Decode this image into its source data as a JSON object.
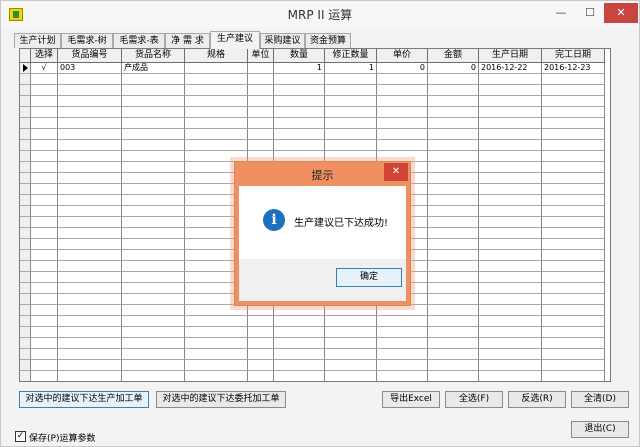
{
  "window": {
    "title": "MRP II 运算",
    "minimize_glyph": "—",
    "maximize_glyph": "☐",
    "close_glyph": "✕"
  },
  "tabs": [
    {
      "label": "生产计划",
      "active": false
    },
    {
      "label": "毛需求-树",
      "active": false
    },
    {
      "label": "毛需求-表",
      "active": false
    },
    {
      "label": "净 需 求",
      "active": false
    },
    {
      "label": "生产建议",
      "active": true
    },
    {
      "label": "采购建议",
      "active": false
    },
    {
      "label": "资金预算",
      "active": false
    }
  ],
  "grid": {
    "columns": [
      "选择",
      "货品编号",
      "货品名称",
      "规格",
      "单位",
      "数量",
      "修正数量",
      "单价",
      "金额",
      "生产日期",
      "完工日期"
    ],
    "rows": [
      {
        "select": "√",
        "item_no": "003",
        "item_name": "产成品",
        "spec": "",
        "unit": "",
        "qty": "1",
        "adjusted_qty": "1",
        "unit_price": "0",
        "amount": "0",
        "production_date": "2016-12-22",
        "completion_date": "2016-12-23"
      }
    ]
  },
  "buttons": {
    "issue_production_order": "对选中的建议下达生产加工单",
    "issue_outsourcing_order": "对选中的建议下达委托加工单",
    "export_excel": "导出Excel",
    "select_all": "全选(F)",
    "invert_selection": "反选(R)",
    "clear_all": "全清(D)",
    "exit": "退出(C)"
  },
  "save_option": {
    "label": "保存(P)运算参数",
    "checked": true,
    "check_glyph": "✓"
  },
  "dialog": {
    "title": "提示",
    "message": "生产建议已下达成功!",
    "ok_label": "确定",
    "close_glyph": "✕",
    "icon_glyph": "i"
  },
  "colors": {
    "dialog_frame": "#ef9063",
    "dialog_close": "#cf4437",
    "info_icon": "#1d6fc2",
    "window_close": "#c7463f"
  }
}
